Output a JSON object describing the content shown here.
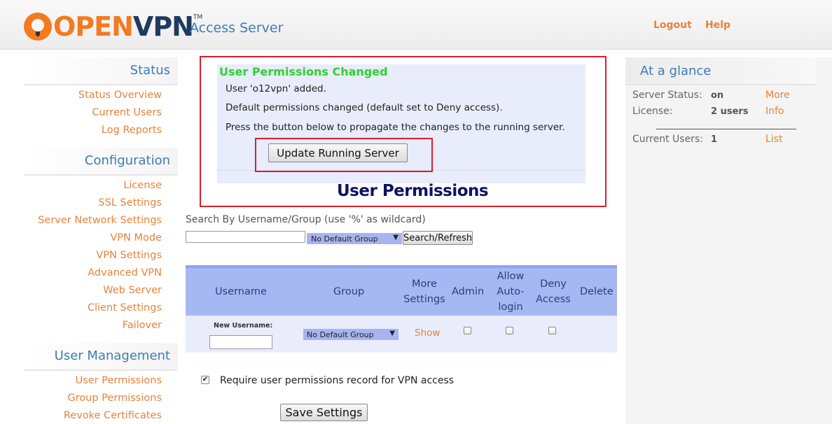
{
  "header": {
    "logo_text_a": "OPEN",
    "logo_text_b": "VPN",
    "logo_tm": "TM",
    "product": "Access Server",
    "logout": "Logout",
    "help": "Help"
  },
  "sidebar": {
    "status": {
      "heading": "Status",
      "items": [
        "Status Overview",
        "Current Users",
        "Log Reports"
      ]
    },
    "configuration": {
      "heading": "Configuration",
      "items": [
        "License",
        "SSL Settings",
        "Server Network Settings",
        "VPN Mode",
        "VPN Settings",
        "Advanced VPN",
        "Web Server",
        "Client Settings",
        "Failover"
      ]
    },
    "user_management": {
      "heading": "User Management",
      "items": [
        "User Permissions",
        "Group Permissions",
        "Revoke Certificates"
      ]
    }
  },
  "message": {
    "title": "User Permissions Changed",
    "line1": "User 'o12vpn' added.",
    "line2": "Default permissions changed (default set to Deny access).",
    "line3": "Press the button below to propagate the changes to the running server.",
    "button": "Update Running Server"
  },
  "page_title": "User Permissions",
  "search": {
    "label": "Search By Username/Group (use '%' as wildcard)",
    "value": "",
    "group_select": "No Default Group",
    "button": "Search/Refresh"
  },
  "table": {
    "headers": {
      "username": "Username",
      "group": "Group",
      "more1": "More",
      "more2": "Settings",
      "admin": "Admin",
      "allow1": "Allow",
      "allow2": "Auto-",
      "allow3": "login",
      "deny1": "Deny",
      "deny2": "Access",
      "delete": "Delete"
    },
    "new_row": {
      "label": "New Username:",
      "value": "",
      "group_select": "No Default Group",
      "show": "Show",
      "admin_checked": false,
      "autologin_checked": false,
      "deny_checked": false
    }
  },
  "require": {
    "checked": true,
    "label": "Require user permissions record for VPN access"
  },
  "save_button": "Save Settings",
  "glance": {
    "heading": "At a glance",
    "server_status_label": "Server Status:",
    "server_status_value": "on",
    "more": "More",
    "license_label": "License:",
    "license_value": "2 users",
    "info": "Info",
    "current_users_label": "Current Users:",
    "current_users_value": "1",
    "list": "List"
  }
}
